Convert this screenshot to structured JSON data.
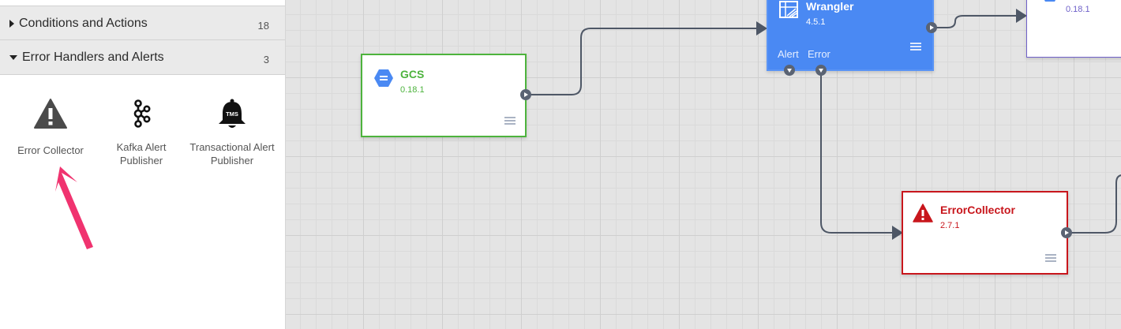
{
  "sidebar": {
    "sections": [
      {
        "label": "Conditions and Actions",
        "count": "18",
        "expanded": false
      },
      {
        "label": "Error Handlers and Alerts",
        "count": "3",
        "expanded": true
      }
    ],
    "plugins": [
      {
        "label": "Error Collector",
        "icon": "warning-triangle-icon"
      },
      {
        "label": "Kafka Alert Publisher",
        "icon": "kafka-icon"
      },
      {
        "label": "Transactional Alert Publisher",
        "icon": "bell-icon",
        "icon_text": "TMS"
      }
    ]
  },
  "canvas": {
    "nodes": {
      "gcs": {
        "title": "GCS",
        "version": "0.18.1",
        "icon": "gcs-hexagon-icon",
        "color": "#4db33d"
      },
      "wrangler": {
        "title": "Wrangler",
        "version": "4.5.1",
        "icon": "wrangler-icon",
        "color": "#4a89f3",
        "port_labels": {
          "alert": "Alert",
          "error": "Error"
        }
      },
      "topright": {
        "version": "0.18.1",
        "icon": "gcs-hexagon-icon",
        "color": "#6f61c9"
      },
      "errorcollector": {
        "title": "ErrorCollector",
        "version": "2.7.1",
        "icon": "warning-triangle-icon",
        "color": "#c8161c"
      }
    },
    "colors": {
      "connector": "#4e5766",
      "annotation_arrow": "#f0336f"
    }
  }
}
